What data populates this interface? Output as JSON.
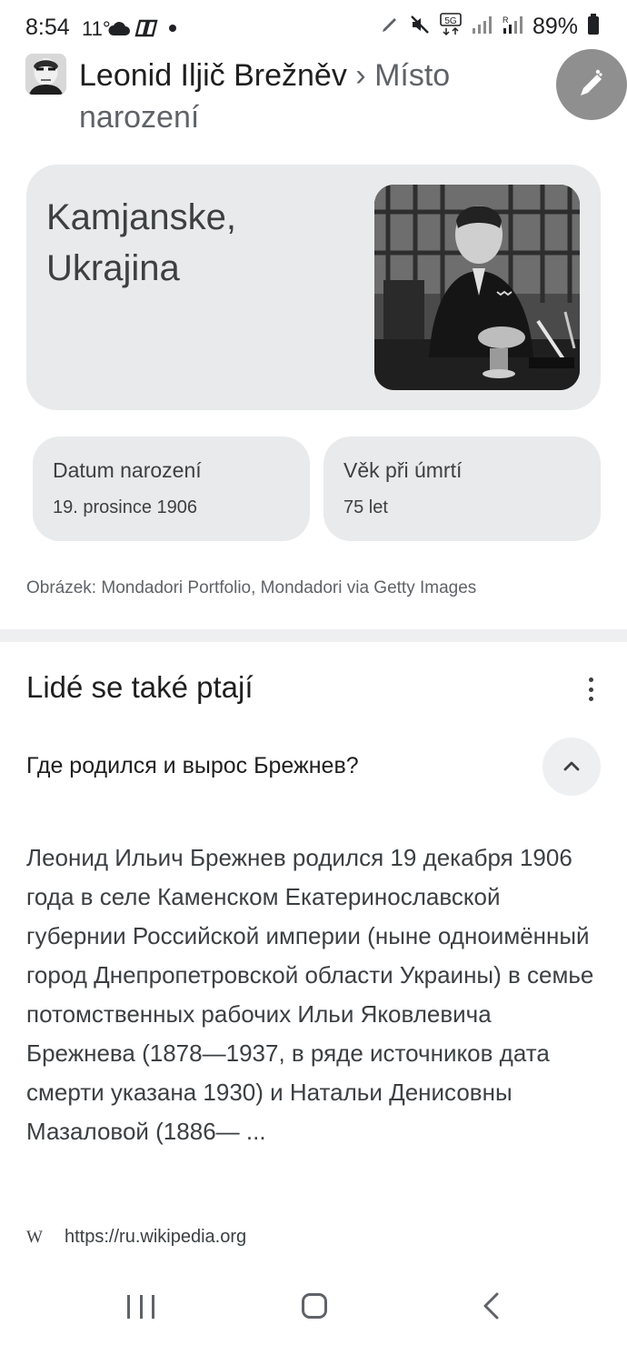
{
  "status_bar": {
    "time": "8:54",
    "temperature": "11°",
    "battery": "89%",
    "network": "5G"
  },
  "header": {
    "entity": "Leonid Iljič Brežněv",
    "separator": "›",
    "attribute": "Místo narození"
  },
  "answer": {
    "line1": "Kamjanske,",
    "line2": "Ukrajina"
  },
  "facts": [
    {
      "label": "Datum narození",
      "value": "19. prosince 1906"
    },
    {
      "label": "Věk při úmrtí",
      "value": "75 let"
    }
  ],
  "image_credit": "Obrázek: Mondadori Portfolio, Mondadori via Getty Images",
  "people_also_ask": {
    "title": "Lidé se také ptají",
    "question": "Где родился и вырос Брежнев?",
    "answer": "Леонид Ильич Брежнев родился 19 декабря 1906 года в селе Каменском Екатеринославской губернии Российской империи (ныне одноимённый город Днепропетровской области Украины) в семье потомственных рабочих Ильи Яковлевича Брежнева (1878—1937, в ряде источников дата смерти указана 1930) и Натальи Денисовны Мазаловой (1886— ...",
    "source_icon": "W",
    "source_url": "https://ru.wikipedia.org"
  },
  "colors": {
    "card_bg": "#e9eaeb",
    "fab_bg": "#8f8f8f",
    "divider": "#eeeff1"
  }
}
